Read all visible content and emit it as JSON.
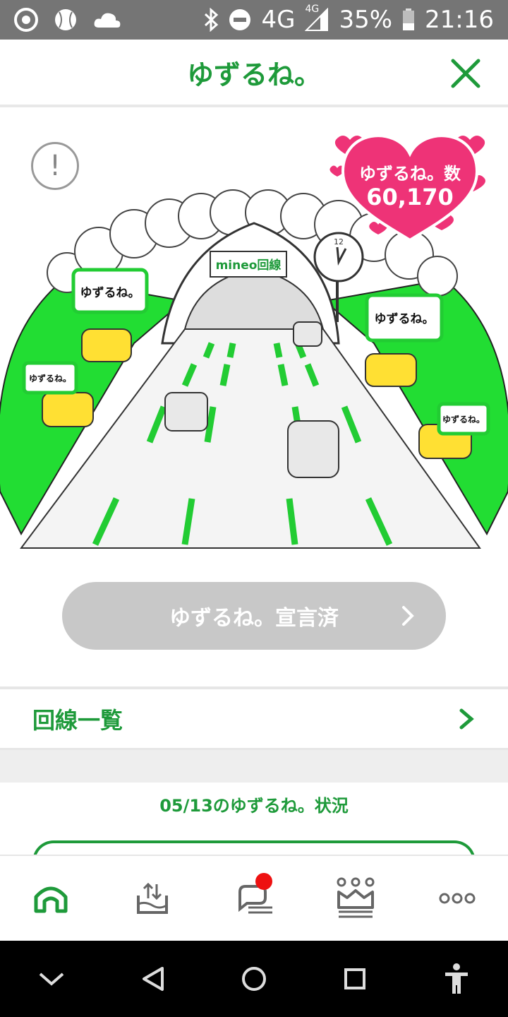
{
  "status_bar": {
    "network": "4G",
    "network_small": "4G",
    "battery": "35%",
    "time": "21:16"
  },
  "header": {
    "title": "ゆずるね。"
  },
  "hero": {
    "heart_label": "ゆずるね。数",
    "heart_count": "60,170",
    "illustration": {
      "sign": "mineo回線",
      "clock_number": "12",
      "bubbles": [
        "ゆずるね。",
        "ゆずるね。",
        "ゆずるね。",
        "ゆずるね。"
      ]
    },
    "declare_button": "ゆずるね。宣言済"
  },
  "line_list": {
    "label": "回線一覧"
  },
  "status_section": {
    "title": "05/13のゆずるね。状況"
  },
  "bottom_nav": {
    "items": [
      "home-icon",
      "upload-tray-icon",
      "chat-icon",
      "crown-icon",
      "more-icon"
    ]
  },
  "colors": {
    "brand_green": "#1e9a3a",
    "field_green": "#22dd33",
    "heart_pink": "#ee3377",
    "button_gray": "#c8c8c8"
  }
}
